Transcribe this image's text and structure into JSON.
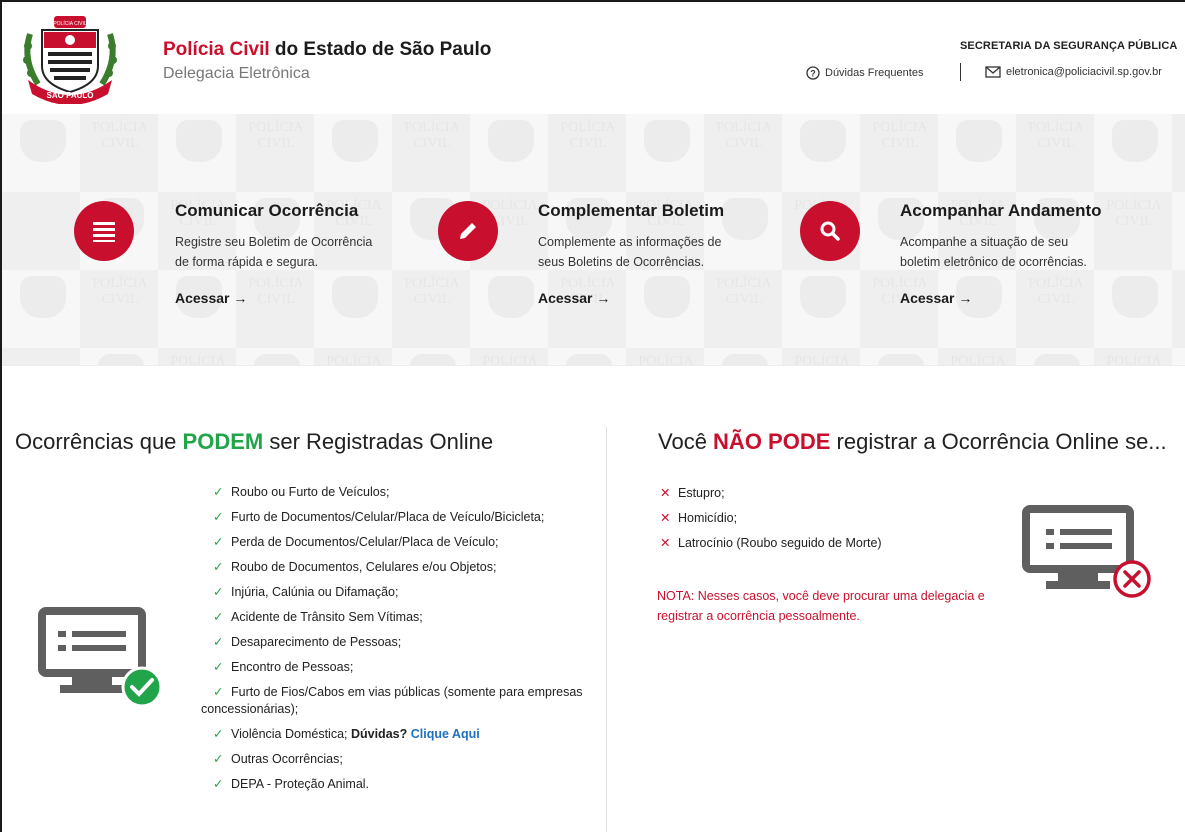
{
  "header": {
    "title_highlight": "Polícia Civil",
    "title_rest": " do Estado de São Paulo",
    "subtitle": "Delegacia Eletrônica",
    "secretaria": "SECRETARIA DA SEGURANÇA PÚBLICA",
    "faq_label": "Dúvidas Frequentes",
    "email_label": "eletronica@policiacivil.sp.gov.br",
    "logo_text": "SÃO PAULO",
    "logo_top_text": "POLÍCIA CIVIL"
  },
  "banner": {
    "watermark_text_1": "POLÍCIA",
    "watermark_text_2": "CIVIL",
    "cards": [
      {
        "icon": "list-icon",
        "title": "Comunicar Ocorrência",
        "desc_line1": "Registre seu Boletim de Ocorrência",
        "desc_line2": "de forma rápida e segura.",
        "link": "Acessar →"
      },
      {
        "icon": "pencil-icon",
        "title": "Complementar Boletim",
        "desc_line1": "Complemente as informações de",
        "desc_line2": "seus Boletins de Ocorrências.",
        "link": "Acessar →"
      },
      {
        "icon": "search-icon",
        "title": "Acompanhar Andamento",
        "desc_line1": "Acompanhe a situação de seu",
        "desc_line2": "boletim eletrônico de ocorrências.",
        "link": "Acessar →"
      }
    ]
  },
  "can_section": {
    "heading_pre": "Ocorrências que ",
    "heading_highlight": "PODEM",
    "heading_post": " ser Registradas Online",
    "items": [
      "Roubo ou Furto de Veículos;",
      "Furto de Documentos/Celular/Placa de Veículo/Bicicleta;",
      "Perda de Documentos/Celular/Placa de Veículo;",
      "Roubo de Documentos, Celulares e/ou Objetos;",
      "Injúria, Calúnia ou Difamação;",
      "Acidente de Trânsito Sem Vítimas;",
      "Desaparecimento de Pessoas;",
      "Encontro de Pessoas;",
      "Furto de Fios/Cabos em vias públicas (somente para empresas concessionárias);",
      "Violência Doméstica; ",
      "Outras Ocorrências;",
      "DEPA - Proteção Animal."
    ],
    "duvidas_label": "Dúvidas?",
    "clique_label": "Clique Aqui"
  },
  "cannot_section": {
    "heading_pre": "Você ",
    "heading_highlight": "NÃO PODE",
    "heading_post": " registrar a Ocorrência Online se...",
    "items": [
      "Estupro;",
      "Homicídio;",
      "Latrocínio (Roubo seguido de Morte)"
    ],
    "nota": "NOTA: Nesses casos, você deve procurar uma delegacia e registrar a ocorrência pessoalmente."
  },
  "colors": {
    "brand_red": "#c8102e",
    "ok_green": "#21a44a",
    "link_blue": "#1f6fbf",
    "monitor_gray": "#5f5f5f"
  }
}
